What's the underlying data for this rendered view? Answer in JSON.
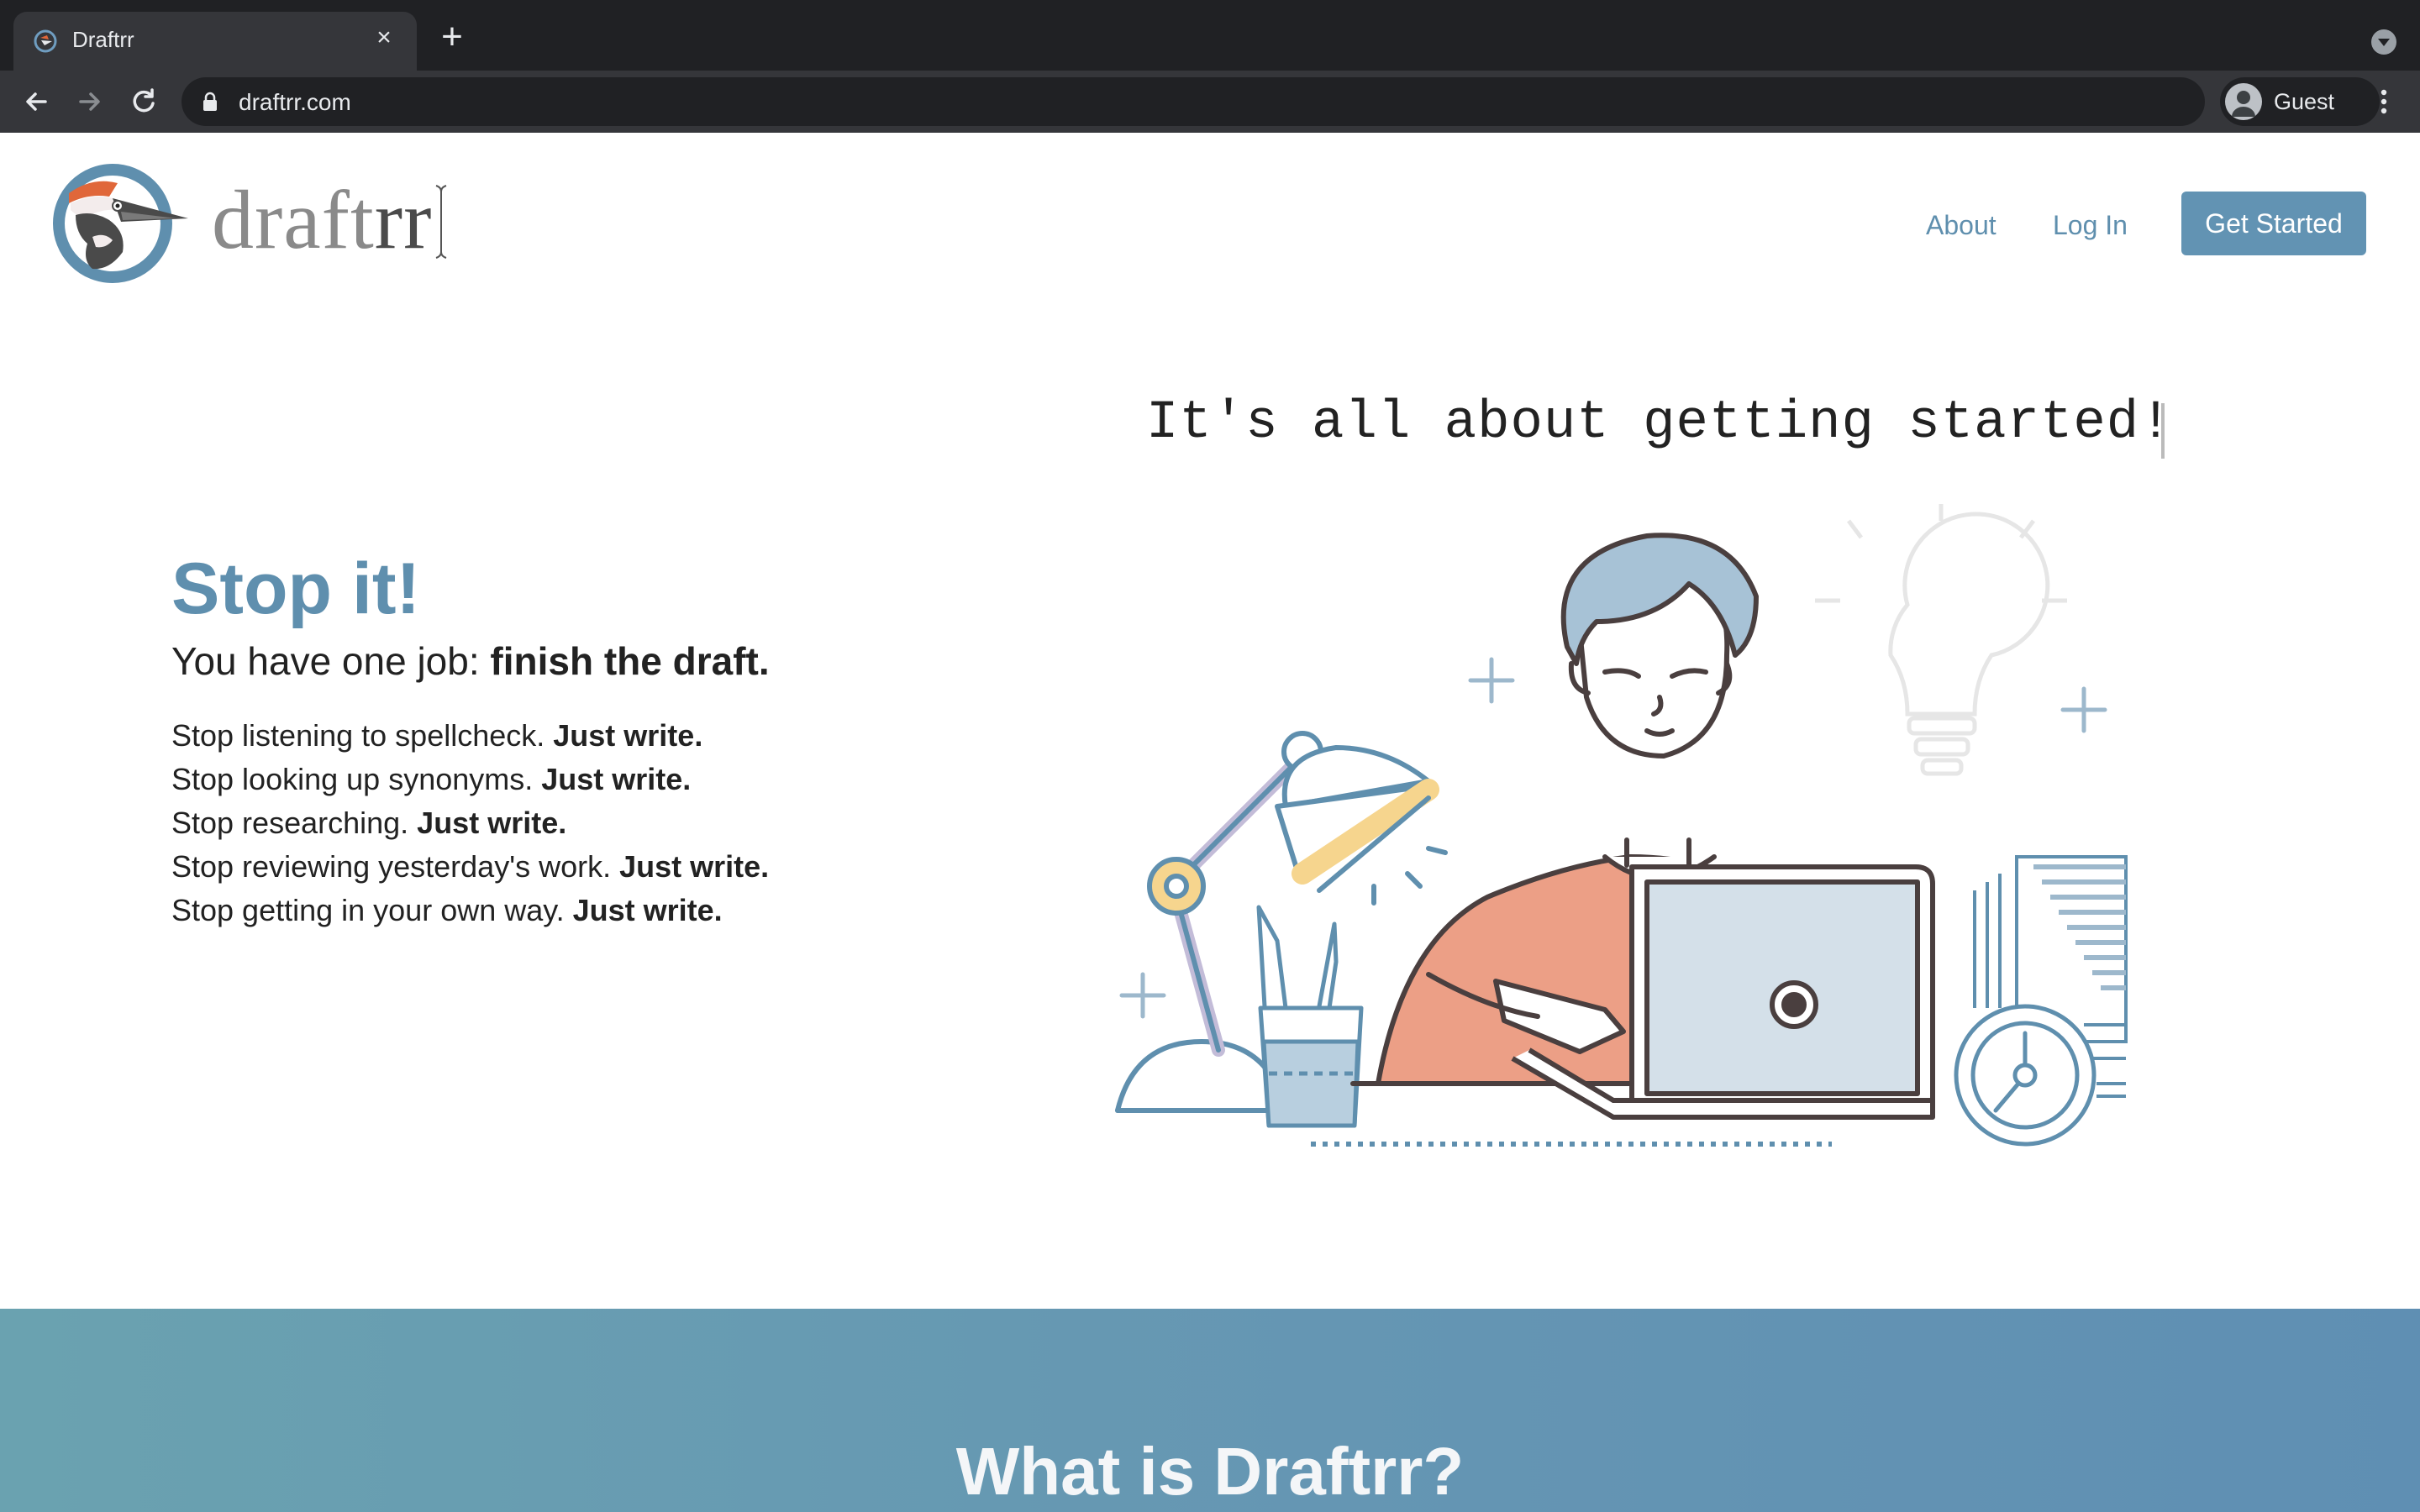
{
  "browser": {
    "tab_title": "Draftrr",
    "url": "draftrr.com",
    "profile_label": "Guest"
  },
  "header": {
    "logo_text_light": "draft",
    "logo_text_dark": "rr",
    "nav": {
      "about": "About",
      "login": "Log In",
      "get_started": "Get Started"
    }
  },
  "hero": {
    "tagline": "It's all about getting started!",
    "title": "Stop it!",
    "subtitle_prefix": "You have one job: ",
    "subtitle_bold": "finish the draft.",
    "lines": [
      {
        "text": "Stop listening to spellcheck. ",
        "bold": "Just write."
      },
      {
        "text": "Stop looking up synonyms. ",
        "bold": "Just write."
      },
      {
        "text": "Stop researching. ",
        "bold": "Just write."
      },
      {
        "text": "Stop reviewing yesterday's work. ",
        "bold": "Just write."
      },
      {
        "text": "Stop getting in your own way. ",
        "bold": "Just write."
      }
    ]
  },
  "band": {
    "title": "What is Draftrr?"
  },
  "colors": {
    "brand_blue": "#6293b3",
    "link_blue": "#5f8fae",
    "shirt_orange": "#ec9f86",
    "lamp_yellow": "#f6d58e",
    "line_dark": "#4a3f3f"
  },
  "icons": [
    "favicon-icon",
    "close-icon",
    "plus-icon",
    "back-arrow-icon",
    "forward-arrow-icon",
    "reload-icon",
    "lock-icon",
    "profile-avatar-icon",
    "kebab-menu-icon",
    "woodpecker-logo-icon",
    "text-cursor-icon"
  ]
}
